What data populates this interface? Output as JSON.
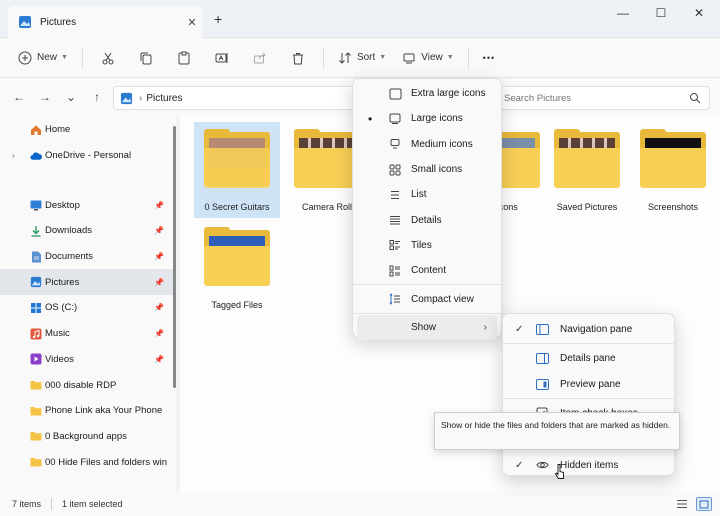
{
  "window": {
    "tab_title": "Pictures",
    "tab_close": "✕",
    "new_tab": "+",
    "minimize": "—",
    "maximize": "☐",
    "close": "✕"
  },
  "toolbar": {
    "new_label": "New",
    "sort_label": "Sort",
    "view_label": "View",
    "more": "•••"
  },
  "nav": {
    "back": "←",
    "forward": "→",
    "recent": "⌄",
    "up": "↑",
    "breadcrumb_sep": "›",
    "breadcrumb": "Pictures",
    "search_placeholder": "Search Pictures"
  },
  "sidebar": {
    "items": [
      {
        "label": "Home",
        "icon": "home-icon"
      },
      {
        "label": "OneDrive - Personal",
        "icon": "cloud-icon"
      },
      {
        "label": "Desktop",
        "icon": "desktop-icon",
        "pinned": true
      },
      {
        "label": "Downloads",
        "icon": "download-icon",
        "pinned": true
      },
      {
        "label": "Documents",
        "icon": "document-icon",
        "pinned": true
      },
      {
        "label": "Pictures",
        "icon": "pictures-icon",
        "pinned": true,
        "selected": true
      },
      {
        "label": "OS (C:)",
        "icon": "drive-icon",
        "pinned": true
      },
      {
        "label": "Music",
        "icon": "music-icon",
        "pinned": true
      },
      {
        "label": "Videos",
        "icon": "video-icon",
        "pinned": true
      },
      {
        "label": "000 disable RDP",
        "icon": "folder-icon"
      },
      {
        "label": "Phone Link aka Your Phone",
        "icon": "folder-icon"
      },
      {
        "label": "0 Background apps",
        "icon": "folder-icon"
      },
      {
        "label": "00 Hide Files and folders win",
        "icon": "folder-icon"
      }
    ],
    "pin_glyph": "📌"
  },
  "content": {
    "folders": [
      {
        "label": "0 Secret Guitars",
        "selected": true
      },
      {
        "label": "Camera Roll"
      },
      {
        "label": "Icons"
      },
      {
        "label": "Saved Pictures"
      },
      {
        "label": "Screenshots"
      },
      {
        "label": "Tagged Files"
      }
    ]
  },
  "status": {
    "items": "7 items",
    "selected": "1 item selected"
  },
  "view_menu": {
    "items": [
      {
        "label": "Extra large icons",
        "icon": "extra-large-icons-icon"
      },
      {
        "label": "Large icons",
        "icon": "large-icons-icon",
        "current": true
      },
      {
        "label": "Medium icons",
        "icon": "medium-icons-icon"
      },
      {
        "label": "Small icons",
        "icon": "small-icons-icon"
      },
      {
        "label": "List",
        "icon": "list-icon"
      },
      {
        "label": "Details",
        "icon": "details-icon"
      },
      {
        "label": "Tiles",
        "icon": "tiles-icon"
      },
      {
        "label": "Content",
        "icon": "content-icon"
      },
      {
        "label": "Compact view",
        "icon": "compact-view-icon"
      },
      {
        "label": "Show",
        "icon": "",
        "submenu": true
      }
    ],
    "current_marker": "•",
    "submenu_arrow": "›"
  },
  "show_menu": {
    "items": [
      {
        "label": "Navigation pane",
        "checked": true
      },
      {
        "label": "Details pane"
      },
      {
        "label": "Preview pane"
      },
      {
        "label": "Item check boxes"
      },
      {
        "label": "Hidden items",
        "checked": true
      }
    ],
    "check_glyph": "✓"
  },
  "tooltip": {
    "text": "Show or hide the files and folders that are marked as hidden."
  },
  "colors": {
    "accent": "#0067c0",
    "folder": "#f7cf55",
    "selection": "#cfe3f7"
  }
}
